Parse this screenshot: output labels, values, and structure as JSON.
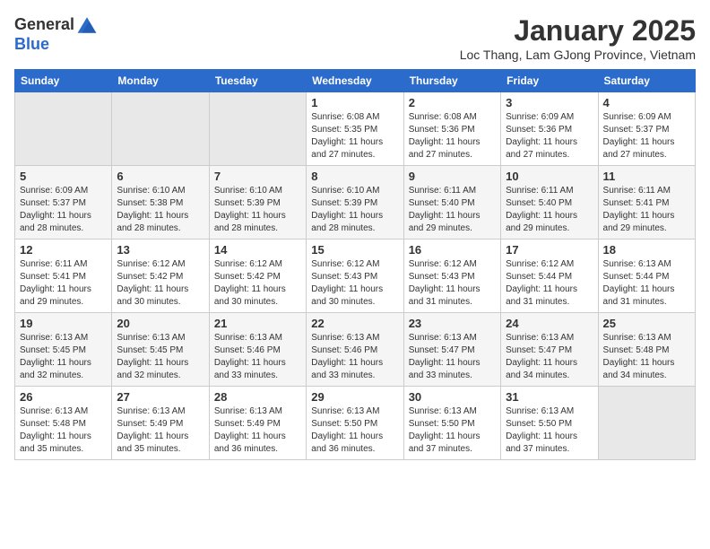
{
  "logo": {
    "general": "General",
    "blue": "Blue"
  },
  "title": "January 2025",
  "subtitle": "Loc Thang, Lam GJong Province, Vietnam",
  "days_of_week": [
    "Sunday",
    "Monday",
    "Tuesday",
    "Wednesday",
    "Thursday",
    "Friday",
    "Saturday"
  ],
  "weeks": [
    [
      {
        "day": "",
        "empty": true
      },
      {
        "day": "",
        "empty": true
      },
      {
        "day": "",
        "empty": true
      },
      {
        "day": "1",
        "sunrise": "6:08 AM",
        "sunset": "5:35 PM",
        "daylight": "11 hours and 27 minutes."
      },
      {
        "day": "2",
        "sunrise": "6:08 AM",
        "sunset": "5:36 PM",
        "daylight": "11 hours and 27 minutes."
      },
      {
        "day": "3",
        "sunrise": "6:09 AM",
        "sunset": "5:36 PM",
        "daylight": "11 hours and 27 minutes."
      },
      {
        "day": "4",
        "sunrise": "6:09 AM",
        "sunset": "5:37 PM",
        "daylight": "11 hours and 27 minutes."
      }
    ],
    [
      {
        "day": "5",
        "sunrise": "6:09 AM",
        "sunset": "5:37 PM",
        "daylight": "11 hours and 28 minutes."
      },
      {
        "day": "6",
        "sunrise": "6:10 AM",
        "sunset": "5:38 PM",
        "daylight": "11 hours and 28 minutes."
      },
      {
        "day": "7",
        "sunrise": "6:10 AM",
        "sunset": "5:39 PM",
        "daylight": "11 hours and 28 minutes."
      },
      {
        "day": "8",
        "sunrise": "6:10 AM",
        "sunset": "5:39 PM",
        "daylight": "11 hours and 28 minutes."
      },
      {
        "day": "9",
        "sunrise": "6:11 AM",
        "sunset": "5:40 PM",
        "daylight": "11 hours and 29 minutes."
      },
      {
        "day": "10",
        "sunrise": "6:11 AM",
        "sunset": "5:40 PM",
        "daylight": "11 hours and 29 minutes."
      },
      {
        "day": "11",
        "sunrise": "6:11 AM",
        "sunset": "5:41 PM",
        "daylight": "11 hours and 29 minutes."
      }
    ],
    [
      {
        "day": "12",
        "sunrise": "6:11 AM",
        "sunset": "5:41 PM",
        "daylight": "11 hours and 29 minutes."
      },
      {
        "day": "13",
        "sunrise": "6:12 AM",
        "sunset": "5:42 PM",
        "daylight": "11 hours and 30 minutes."
      },
      {
        "day": "14",
        "sunrise": "6:12 AM",
        "sunset": "5:42 PM",
        "daylight": "11 hours and 30 minutes."
      },
      {
        "day": "15",
        "sunrise": "6:12 AM",
        "sunset": "5:43 PM",
        "daylight": "11 hours and 30 minutes."
      },
      {
        "day": "16",
        "sunrise": "6:12 AM",
        "sunset": "5:43 PM",
        "daylight": "11 hours and 31 minutes."
      },
      {
        "day": "17",
        "sunrise": "6:12 AM",
        "sunset": "5:44 PM",
        "daylight": "11 hours and 31 minutes."
      },
      {
        "day": "18",
        "sunrise": "6:13 AM",
        "sunset": "5:44 PM",
        "daylight": "11 hours and 31 minutes."
      }
    ],
    [
      {
        "day": "19",
        "sunrise": "6:13 AM",
        "sunset": "5:45 PM",
        "daylight": "11 hours and 32 minutes."
      },
      {
        "day": "20",
        "sunrise": "6:13 AM",
        "sunset": "5:45 PM",
        "daylight": "11 hours and 32 minutes."
      },
      {
        "day": "21",
        "sunrise": "6:13 AM",
        "sunset": "5:46 PM",
        "daylight": "11 hours and 33 minutes."
      },
      {
        "day": "22",
        "sunrise": "6:13 AM",
        "sunset": "5:46 PM",
        "daylight": "11 hours and 33 minutes."
      },
      {
        "day": "23",
        "sunrise": "6:13 AM",
        "sunset": "5:47 PM",
        "daylight": "11 hours and 33 minutes."
      },
      {
        "day": "24",
        "sunrise": "6:13 AM",
        "sunset": "5:47 PM",
        "daylight": "11 hours and 34 minutes."
      },
      {
        "day": "25",
        "sunrise": "6:13 AM",
        "sunset": "5:48 PM",
        "daylight": "11 hours and 34 minutes."
      }
    ],
    [
      {
        "day": "26",
        "sunrise": "6:13 AM",
        "sunset": "5:48 PM",
        "daylight": "11 hours and 35 minutes."
      },
      {
        "day": "27",
        "sunrise": "6:13 AM",
        "sunset": "5:49 PM",
        "daylight": "11 hours and 35 minutes."
      },
      {
        "day": "28",
        "sunrise": "6:13 AM",
        "sunset": "5:49 PM",
        "daylight": "11 hours and 36 minutes."
      },
      {
        "day": "29",
        "sunrise": "6:13 AM",
        "sunset": "5:50 PM",
        "daylight": "11 hours and 36 minutes."
      },
      {
        "day": "30",
        "sunrise": "6:13 AM",
        "sunset": "5:50 PM",
        "daylight": "11 hours and 37 minutes."
      },
      {
        "day": "31",
        "sunrise": "6:13 AM",
        "sunset": "5:50 PM",
        "daylight": "11 hours and 37 minutes."
      },
      {
        "day": "",
        "empty": true
      }
    ]
  ],
  "labels": {
    "sunrise_prefix": "Sunrise: ",
    "sunset_prefix": "Sunset: ",
    "daylight_prefix": "Daylight: "
  }
}
